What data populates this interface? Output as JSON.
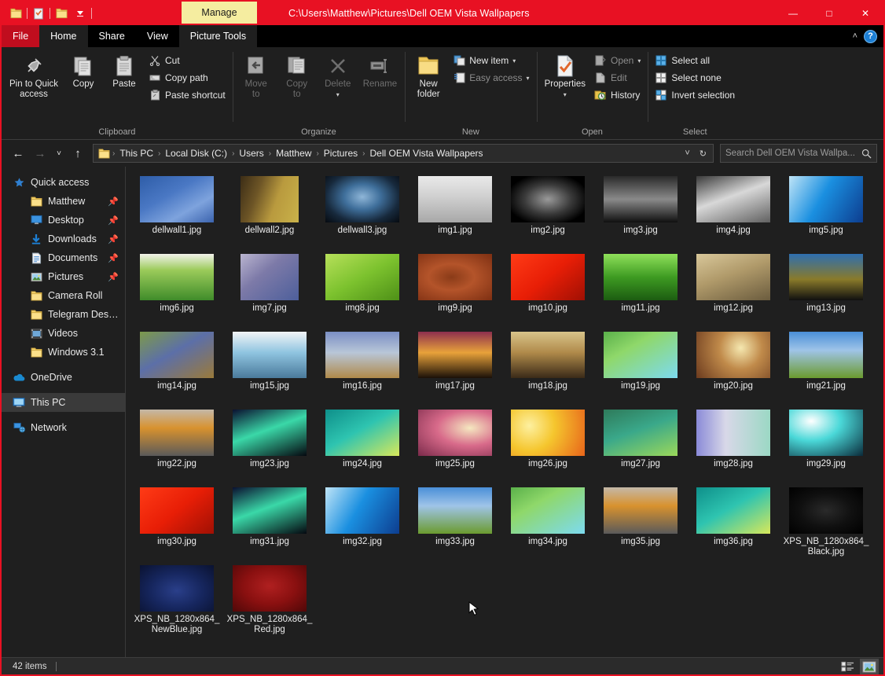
{
  "window": {
    "title_path": "C:\\Users\\Matthew\\Pictures\\Dell OEM Vista Wallpapers",
    "contextual_tab": "Manage",
    "accent_color": "#e81123",
    "contextual_color": "#f5eda0",
    "minimize": "—",
    "maximize": "□",
    "close": "✕"
  },
  "quick_access_toolbar": [
    {
      "name": "folder-properties-icon",
      "glyph": "folder"
    },
    {
      "name": "new-folder-icon",
      "glyph": "checked-doc"
    },
    {
      "name": "undo-icon",
      "glyph": "folder"
    },
    {
      "name": "customize-dropdown-icon",
      "glyph": "caret"
    }
  ],
  "tabs": [
    {
      "label": "File",
      "state": "file"
    },
    {
      "label": "Home",
      "state": "active"
    },
    {
      "label": "Share",
      "state": "normal"
    },
    {
      "label": "View",
      "state": "normal"
    },
    {
      "label": "Picture Tools",
      "state": "contextual"
    }
  ],
  "tabbar_right": {
    "collapse_ribbon": "˄",
    "help": "?"
  },
  "ribbon": {
    "groups": [
      {
        "title": "Clipboard",
        "big": [
          {
            "label_1": "Pin to Quick",
            "label_2": "access",
            "icon": "pin-icon"
          },
          {
            "label_1": "Copy",
            "label_2": "",
            "icon": "copy-icon"
          },
          {
            "label_1": "Paste",
            "label_2": "",
            "icon": "paste-icon"
          }
        ],
        "small": [
          {
            "label": "Cut",
            "icon": "scissors-icon",
            "dim": false
          },
          {
            "label": "Copy path",
            "icon": "copy-path-icon",
            "dim": false
          },
          {
            "label": "Paste shortcut",
            "icon": "paste-shortcut-icon",
            "dim": false
          }
        ]
      },
      {
        "title": "Organize",
        "big": [
          {
            "label_1": "Move",
            "label_2": "to",
            "icon": "move-to-icon",
            "caret": true,
            "dim": true
          },
          {
            "label_1": "Copy",
            "label_2": "to",
            "icon": "copy-to-icon",
            "caret": true,
            "dim": true
          },
          {
            "label_1": "Delete",
            "label_2": "",
            "icon": "delete-icon",
            "caret": true,
            "dim": true
          },
          {
            "label_1": "Rename",
            "label_2": "",
            "icon": "rename-icon",
            "dim": true
          }
        ],
        "small": []
      },
      {
        "title": "New",
        "big": [
          {
            "label_1": "New",
            "label_2": "folder",
            "icon": "new-folder-icon"
          }
        ],
        "small": [
          {
            "label": "New item",
            "icon": "new-item-icon",
            "caret": true
          },
          {
            "label": "Easy access",
            "icon": "easy-access-icon",
            "caret": true,
            "dim": true
          }
        ]
      },
      {
        "title": "Open",
        "big": [
          {
            "label_1": "Properties",
            "label_2": "",
            "icon": "properties-icon",
            "caret": true
          }
        ],
        "small": [
          {
            "label": "Open",
            "icon": "open-icon",
            "caret": true,
            "dim": true
          },
          {
            "label": "Edit",
            "icon": "edit-icon",
            "dim": true
          },
          {
            "label": "History",
            "icon": "history-icon",
            "dim": false
          }
        ]
      },
      {
        "title": "Select",
        "big": [],
        "small": [
          {
            "label": "Select all",
            "icon": "select-all-icon"
          },
          {
            "label": "Select none",
            "icon": "select-none-icon"
          },
          {
            "label": "Invert selection",
            "icon": "invert-selection-icon"
          }
        ]
      }
    ]
  },
  "address_bar": {
    "back": "←",
    "forward": "→",
    "recent": "˅",
    "up": "↑",
    "breadcrumbs": [
      "This PC",
      "Local Disk (C:)",
      "Users",
      "Matthew",
      "Pictures",
      "Dell OEM Vista Wallpapers"
    ],
    "separator": "›",
    "dropdown": "˅",
    "refresh": "↻",
    "search_placeholder": "Search Dell OEM Vista Wallpa...",
    "search_value": "",
    "search_icon": "search-icon"
  },
  "sidebar": {
    "items": [
      {
        "label": "Quick access",
        "icon": "star-icon",
        "level": "root",
        "pinned": false,
        "selected": false
      },
      {
        "label": "Matthew",
        "icon": "folder-icon",
        "level": "child",
        "pinned": true,
        "selected": false
      },
      {
        "label": "Desktop",
        "icon": "desktop-icon",
        "level": "child",
        "pinned": true,
        "selected": false
      },
      {
        "label": "Downloads",
        "icon": "download-icon",
        "level": "child",
        "pinned": true,
        "selected": false
      },
      {
        "label": "Documents",
        "icon": "documents-icon",
        "level": "child",
        "pinned": true,
        "selected": false
      },
      {
        "label": "Pictures",
        "icon": "pictures-icon",
        "level": "child",
        "pinned": true,
        "selected": false
      },
      {
        "label": "Camera Roll",
        "icon": "folder-icon",
        "level": "child",
        "pinned": false,
        "selected": false
      },
      {
        "label": "Telegram Desktop",
        "icon": "folder-icon",
        "level": "child",
        "pinned": false,
        "selected": false
      },
      {
        "label": "Videos",
        "icon": "videos-icon",
        "level": "child",
        "pinned": false,
        "selected": false
      },
      {
        "label": "Windows 3.1",
        "icon": "folder-icon",
        "level": "child",
        "pinned": false,
        "selected": false
      },
      {
        "label": "OneDrive",
        "icon": "onedrive-icon",
        "level": "root",
        "pinned": false,
        "selected": false,
        "gap_before": true
      },
      {
        "label": "This PC",
        "icon": "pc-icon",
        "level": "root",
        "pinned": false,
        "selected": true,
        "gap_before": true
      },
      {
        "label": "Network",
        "icon": "network-icon",
        "level": "root",
        "pinned": false,
        "selected": false,
        "gap_before": true
      }
    ]
  },
  "files": [
    {
      "name": "dellwall1.jpg",
      "shape": "wide",
      "css": "linear-gradient(150deg,#2e5da8 0%,#4a78c4 40%,#7ea3dd 70%,#3b63ae 100%)"
    },
    {
      "name": "dellwall2.jpg",
      "shape": "portrait",
      "css": "linear-gradient(110deg,#3c2d16 0%,#6d5526 30%,#b99a3e 60%,#c9b24a 100%)"
    },
    {
      "name": "dellwall3.jpg",
      "shape": "wide",
      "css": "radial-gradient(ellipse at 50% 45%,#8fb6d8 0%,#3f6f9b 35%,#17293c 70%,#060a10 100%)"
    },
    {
      "name": "img1.jpg",
      "shape": "wide",
      "css": "linear-gradient(180deg,#e9e9e9 0%,#cfcfcf 45%,#a8a8a8 100%)"
    },
    {
      "name": "img2.jpg",
      "shape": "wide",
      "css": "radial-gradient(ellipse at 50% 50%,#9a9a9a 0%,#3a3a3a 45%,#000 80%)"
    },
    {
      "name": "img3.jpg",
      "shape": "wide",
      "css": "linear-gradient(180deg,#2a2a2a 0%,#8a8a8a 50%,#101010 100%)"
    },
    {
      "name": "img4.jpg",
      "shape": "wide",
      "css": "linear-gradient(160deg,#3a3a3a 0%,#d8d8d8 45%,#606060 100%)"
    },
    {
      "name": "img5.jpg",
      "shape": "wide",
      "css": "linear-gradient(120deg,#bfe4f7 0%,#1a8fe0 45%,#0d3d8f 100%)"
    },
    {
      "name": "img6.jpg",
      "shape": "wide",
      "css": "linear-gradient(180deg,#f2f2ea 0%,#9bcb5a 35%,#3f8c2a 100%)"
    },
    {
      "name": "img7.jpg",
      "shape": "portrait",
      "css": "linear-gradient(140deg,#b9b4cf 0%,#7d7aa8 40%,#4d5f9b 100%)"
    },
    {
      "name": "img8.jpg",
      "shape": "wide",
      "css": "linear-gradient(150deg,#b7e05a 0%,#7cc22e 50%,#4e9017 100%)"
    },
    {
      "name": "img9.jpg",
      "shape": "wide",
      "css": "radial-gradient(ellipse at 45% 50%,#8a3b18 0%,#b4542a 40%,#7d2f12 100%)"
    },
    {
      "name": "img10.jpg",
      "shape": "wide",
      "css": "linear-gradient(140deg,#ff3b16 0%,#e81e06 50%,#a01004 100%)"
    },
    {
      "name": "img11.jpg",
      "shape": "wide",
      "css": "linear-gradient(180deg,#8fe05a 0%,#3e9b22 50%,#1c5c11 100%)"
    },
    {
      "name": "img12.jpg",
      "shape": "wide",
      "css": "linear-gradient(160deg,#d8c79a 0%,#b09a6a 45%,#6b5c3e 100%)"
    },
    {
      "name": "img13.jpg",
      "shape": "wide",
      "css": "linear-gradient(180deg,#2e6fb0 0%,#8a7a2a 55%,#101010 100%)"
    },
    {
      "name": "img14.jpg",
      "shape": "wide",
      "css": "linear-gradient(150deg,#7d9a4a 0%,#5c6fa8 45%,#9a7a3a 100%)"
    },
    {
      "name": "img15.jpg",
      "shape": "wide",
      "css": "linear-gradient(180deg,#f2f5f7 0%,#8fc4e0 45%,#4a7a9b 100%)"
    },
    {
      "name": "img16.jpg",
      "shape": "wide",
      "css": "linear-gradient(180deg,#7b8fc4 0%,#b8c6d8 45%,#b08a4a 100%)"
    },
    {
      "name": "img17.jpg",
      "shape": "wide",
      "css": "linear-gradient(180deg,#8e2f4e 0%,#e8a23a 45%,#1a1008 100%)"
    },
    {
      "name": "img18.jpg",
      "shape": "wide",
      "css": "linear-gradient(180deg,#d8c48a 0%,#b08a4a 45%,#3a2a18 100%)"
    },
    {
      "name": "img19.jpg",
      "shape": "wide",
      "css": "linear-gradient(150deg,#5ab04a 0%,#8fd86a 35%,#7ddaf0 100%)"
    },
    {
      "name": "img20.jpg",
      "shape": "wide",
      "css": "radial-gradient(circle at 60% 35%,#f5e8b0 0%,#c08a4a 40%,#6b3a1e 100%)"
    },
    {
      "name": "img21.jpg",
      "shape": "wide",
      "css": "linear-gradient(180deg,#4a8fd8 0%,#9fc4e8 40%,#6b9b2e 100%)"
    },
    {
      "name": "img22.jpg",
      "shape": "wide",
      "css": "linear-gradient(180deg,#c4b8a8 0%,#d8922e 40%,#5a5a5a 100%)"
    },
    {
      "name": "img23.jpg",
      "shape": "wide",
      "css": "linear-gradient(160deg,#0a1030 0%,#3ad8a8 45%,#050810 100%)"
    },
    {
      "name": "img24.jpg",
      "shape": "wide",
      "css": "linear-gradient(150deg,#0e8f8a 0%,#2ec4b0 45%,#d8e85a 100%)"
    },
    {
      "name": "img25.jpg",
      "shape": "wide",
      "css": "radial-gradient(ellipse at 70% 40%,#f5e8c0 0%,#d86a8a 45%,#7a2a4a 100%)"
    },
    {
      "name": "img26.jpg",
      "shape": "wide",
      "css": "radial-gradient(circle at 25% 35%,#fdf0a0 0%,#f5c62e 40%,#e8641a 100%)"
    },
    {
      "name": "img27.jpg",
      "shape": "wide",
      "css": "linear-gradient(160deg,#2e7a5a 0%,#3aa88a 45%,#9bd85a 100%)"
    },
    {
      "name": "img28.jpg",
      "shape": "wide",
      "css": "linear-gradient(90deg,#8a8ad8 0%,#d8d8e8 40%,#9bd8c4 100%)"
    },
    {
      "name": "img29.jpg",
      "shape": "wide",
      "css": "radial-gradient(ellipse at 30% 25%,#ffffff 0%,#4ad8d8 40%,#0a2a3a 100%)"
    },
    {
      "name": "img30.jpg",
      "shape": "wide",
      "css": "linear-gradient(140deg,#ff3b16 0%,#e81e06 50%,#a01004 100%)"
    },
    {
      "name": "img31.jpg",
      "shape": "wide",
      "css": "linear-gradient(160deg,#0a1030 0%,#3ad8a8 45%,#050810 100%)"
    },
    {
      "name": "img32.jpg",
      "shape": "wide",
      "css": "linear-gradient(120deg,#bfe4f7 0%,#1a8fe0 45%,#0d3d8f 100%)"
    },
    {
      "name": "img33.jpg",
      "shape": "wide",
      "css": "linear-gradient(180deg,#4a8fd8 0%,#9fc4e8 40%,#6b9b2e 100%)"
    },
    {
      "name": "img34.jpg",
      "shape": "wide",
      "css": "linear-gradient(150deg,#5ab04a 0%,#8fd86a 35%,#7ddaf0 100%)"
    },
    {
      "name": "img35.jpg",
      "shape": "wide",
      "css": "linear-gradient(180deg,#c4b8a8 0%,#d8922e 40%,#5a5a5a 100%)"
    },
    {
      "name": "img36.jpg",
      "shape": "wide",
      "css": "linear-gradient(150deg,#0e8f8a 0%,#2ec4b0 45%,#d8e85a 100%)"
    },
    {
      "name": "XPS_NB_1280x864_Black.jpg",
      "shape": "wide",
      "css": "radial-gradient(ellipse at 50% 50%,#2a2a2a 0%,#101010 50%,#000 100%)"
    },
    {
      "name": "XPS_NB_1280x864_NewBlue.jpg",
      "shape": "wide",
      "css": "radial-gradient(ellipse at 50% 55%,#2a3f8a 0%,#16265e 50%,#0a1230 100%)"
    },
    {
      "name": "XPS_NB_1280x864_Red.jpg",
      "shape": "wide",
      "css": "radial-gradient(ellipse at 50% 45%,#b02020 0%,#8a1010 50%,#500808 100%)"
    }
  ],
  "status_bar": {
    "item_count": "42 items",
    "view_details": "details-view-icon",
    "view_thumbnails": "thumbnail-view-icon"
  }
}
